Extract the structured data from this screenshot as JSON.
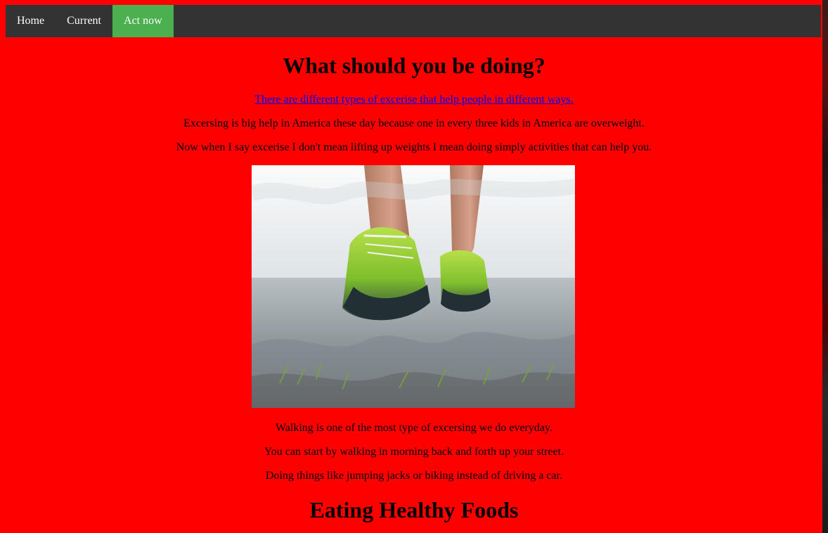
{
  "nav": {
    "items": [
      {
        "label": "Home"
      },
      {
        "label": "Current"
      },
      {
        "label": "Act now"
      }
    ]
  },
  "main": {
    "heading": "What should you be doing?",
    "link_text": "There are different types of excerise that help people in different ways.",
    "paragraphs": [
      "Excersing is big help in America these day because one in every three kids in America are overweight.",
      "Now when I say excerise I don't mean lifting up weights I mean doing simply activities that can help you.",
      "Walking is one of the most type of excersing we do everyday.",
      "You can start by walking in morning back and forth up your street.",
      "Doing things like jumping jacks or biking instead of driving a car."
    ],
    "section_heading": "Eating Healthy Foods"
  },
  "colors": {
    "page_bg": "#ff0000",
    "nav_bg": "#333333",
    "nav_active": "#4caf50",
    "link": "#0000ee"
  }
}
